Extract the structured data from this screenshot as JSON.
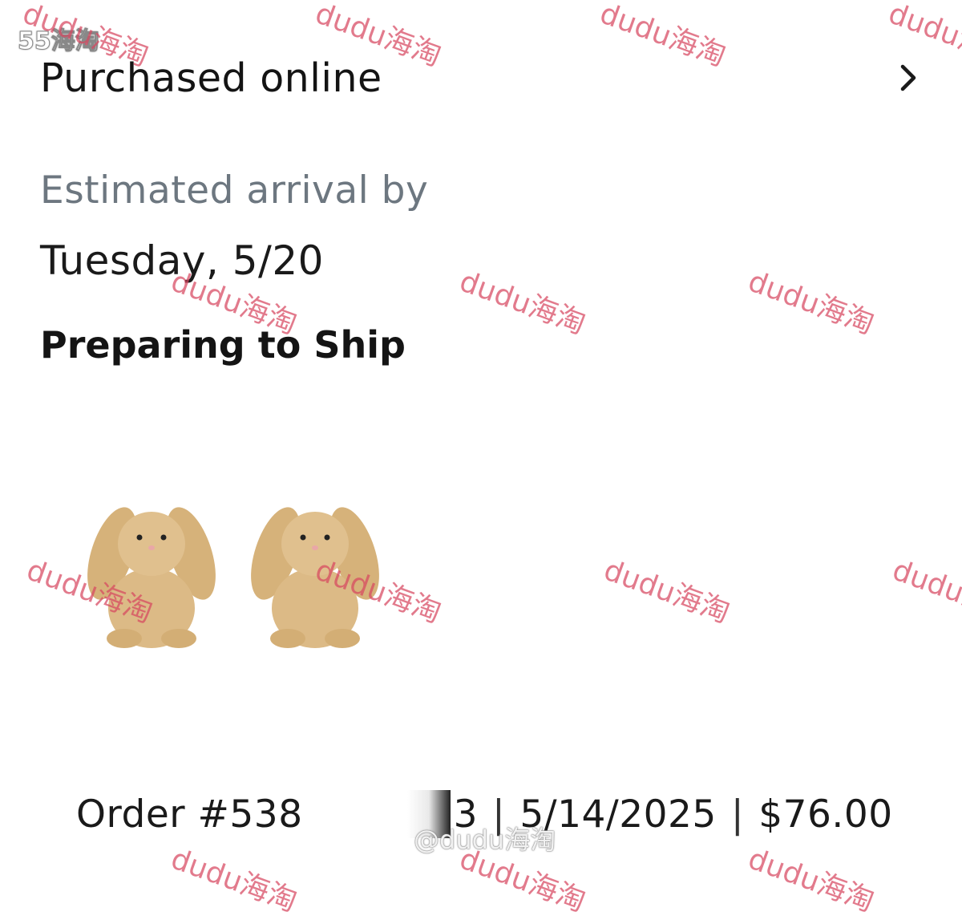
{
  "header": {
    "label": "Purchased online",
    "chevron_icon": "chevron-right-icon"
  },
  "delivery": {
    "eta_label": "Estimated arrival by",
    "eta_date": "Tuesday, 5/20",
    "status": "Preparing to Ship"
  },
  "items": [
    {
      "name": "plush bunny toy"
    },
    {
      "name": "plush bunny toy"
    }
  ],
  "order": {
    "number_prefix": "Order #538",
    "number_suffix": "3",
    "separator": "|",
    "date": "5/14/2025",
    "total": "$76.00"
  },
  "overlay": {
    "corner_logo": "55海淘",
    "bottom_handle": "@dudu海淘",
    "watermark_text": "dudu海淘"
  }
}
